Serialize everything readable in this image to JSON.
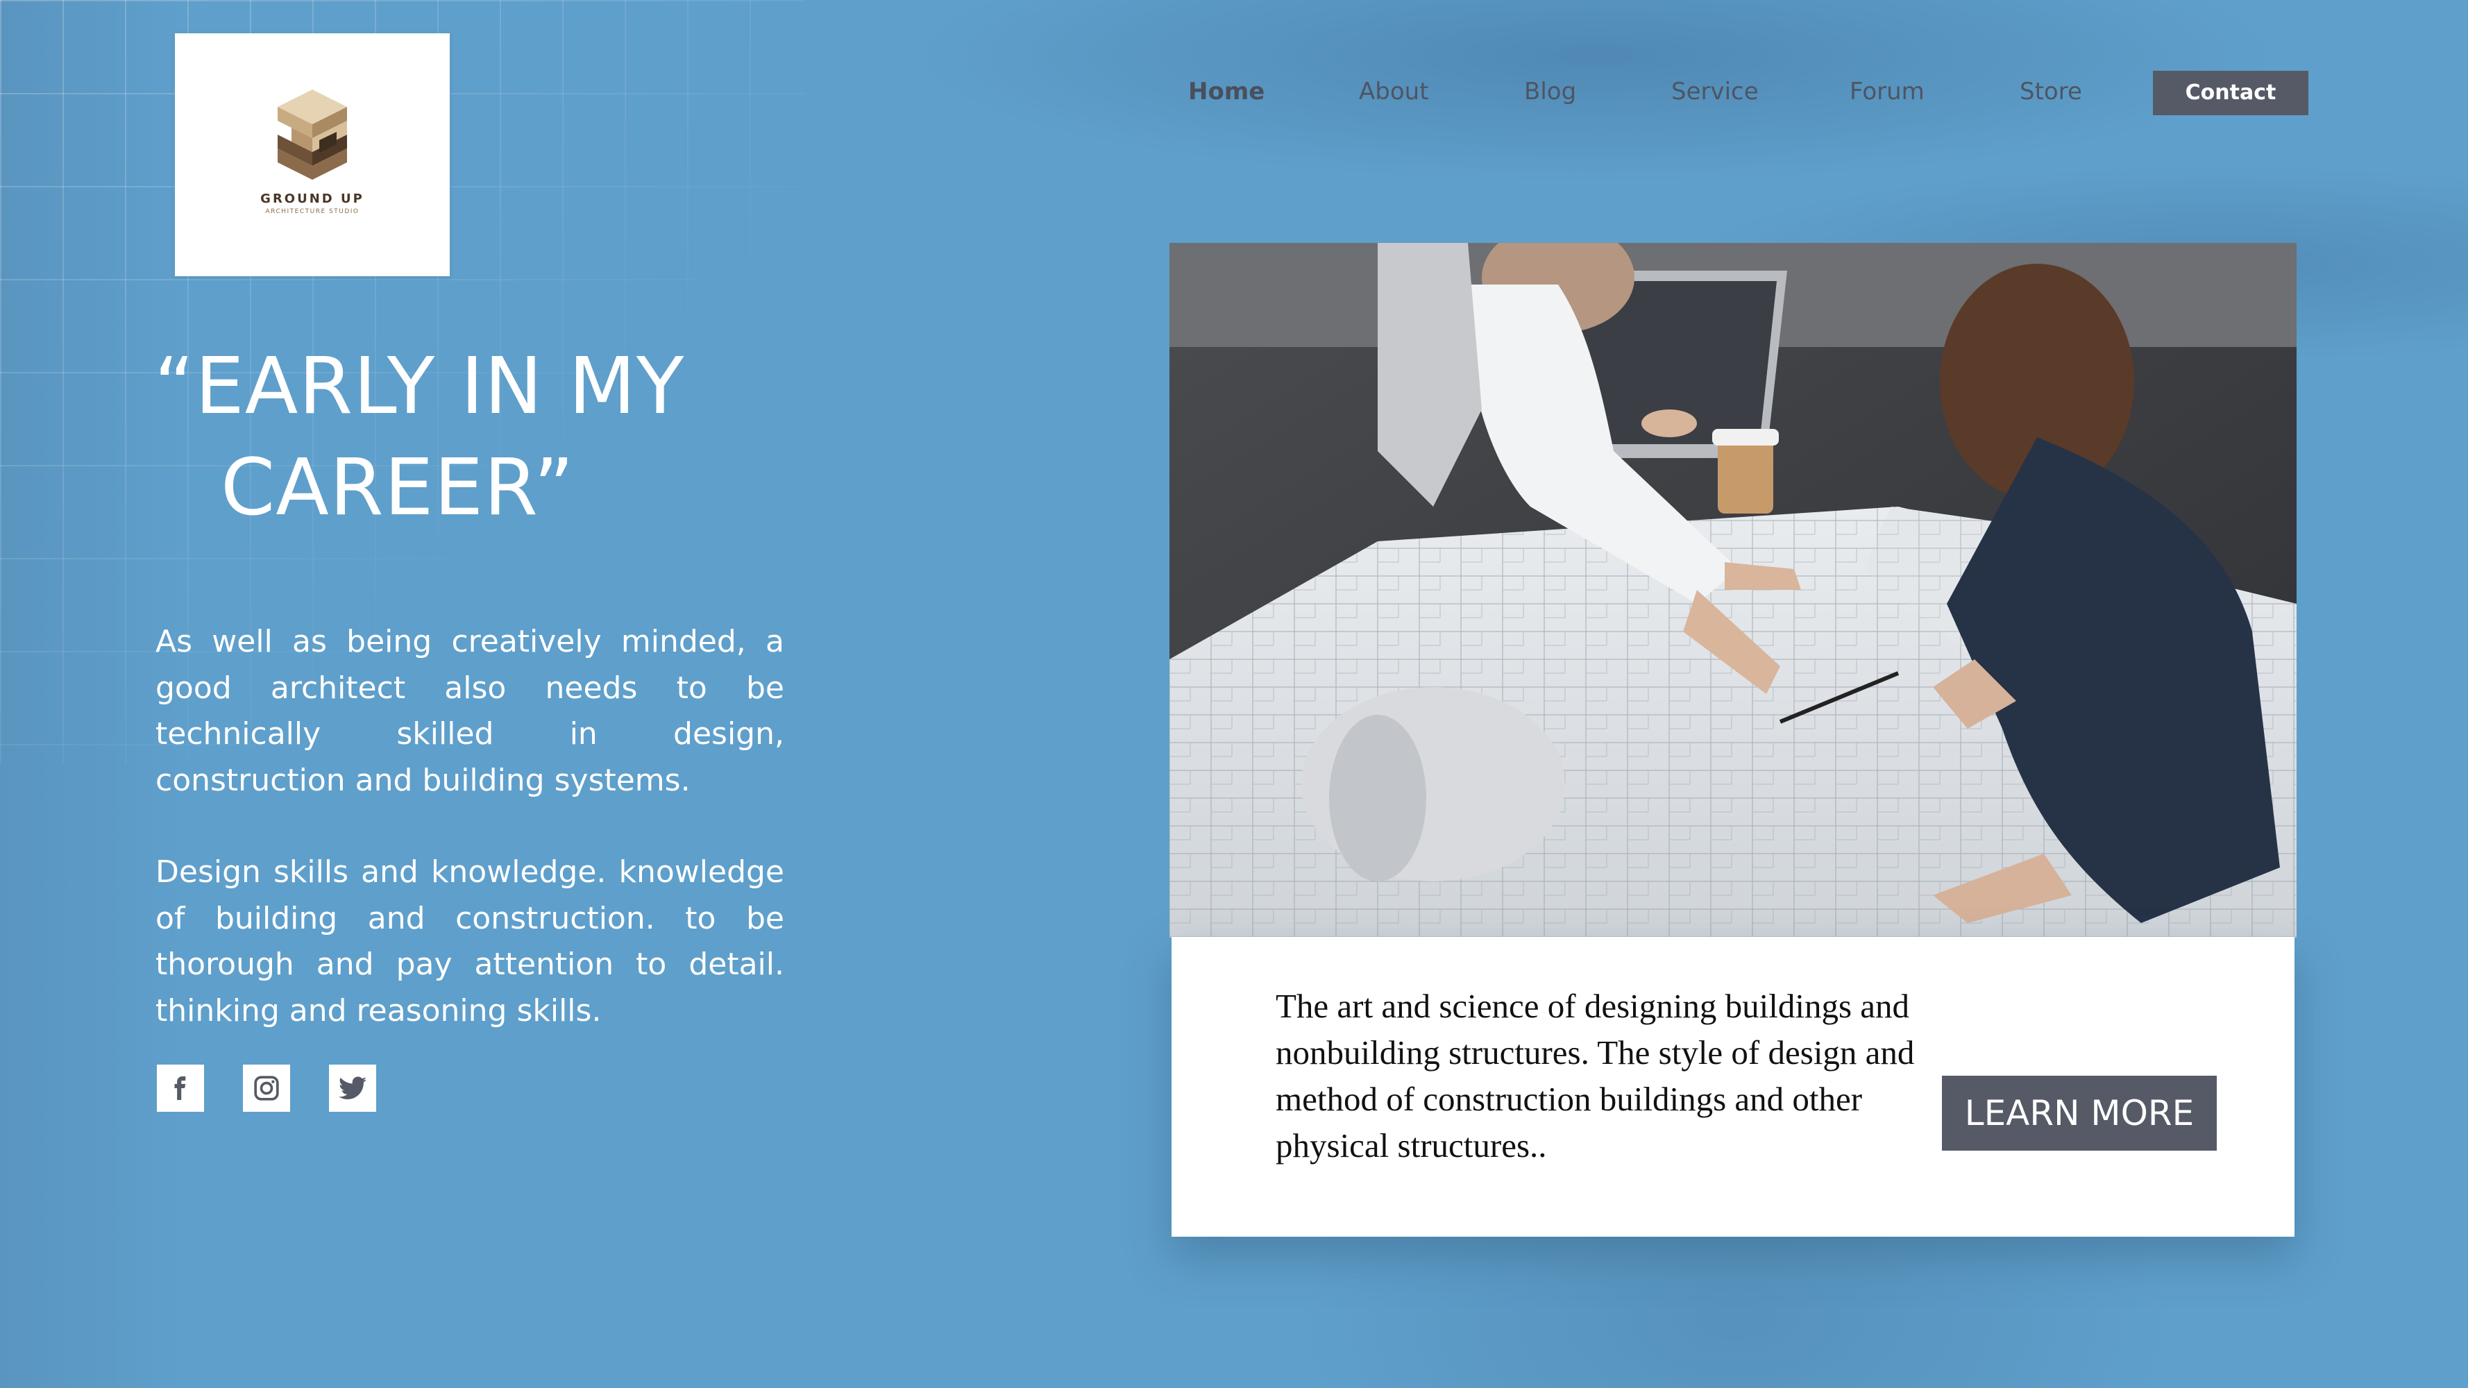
{
  "logo": {
    "name": "GROUND UP",
    "tagline": "ARCHITECTURE STUDIO",
    "icon": "stacked-blocks-logo"
  },
  "nav": {
    "items": [
      {
        "label": "Home",
        "active": true
      },
      {
        "label": "About",
        "active": false
      },
      {
        "label": "Blog",
        "active": false
      },
      {
        "label": "Service",
        "active": false
      },
      {
        "label": "Forum",
        "active": false
      },
      {
        "label": "Store",
        "active": false
      }
    ],
    "contact_label": "Contact"
  },
  "hero": {
    "headline_line1": "“EARLY IN MY",
    "headline_line2": "CAREER”",
    "paragraph1": " As well as being creatively minded, a good architect also needs to be technically skilled in design, construction and building systems.",
    "paragraph2": "Design skills and knowledge. knowledge of building and construction. to be thorough and pay attention to detail. thinking and reasoning skills."
  },
  "social": [
    {
      "icon": "facebook-icon"
    },
    {
      "icon": "instagram-icon"
    },
    {
      "icon": "twitter-icon"
    }
  ],
  "card": {
    "photo_icon": "architects-reviewing-blueprints-photo",
    "text": "The art and science of designing buildings and nonbuilding structures. The style of design and method of construction  buildings and other physical structures..",
    "button_label": "LEARN MORE"
  },
  "colors": {
    "background": "#5f9fcb",
    "button": "#555a66",
    "text_light": "#ffffff",
    "nav_text": "#4e5563"
  }
}
